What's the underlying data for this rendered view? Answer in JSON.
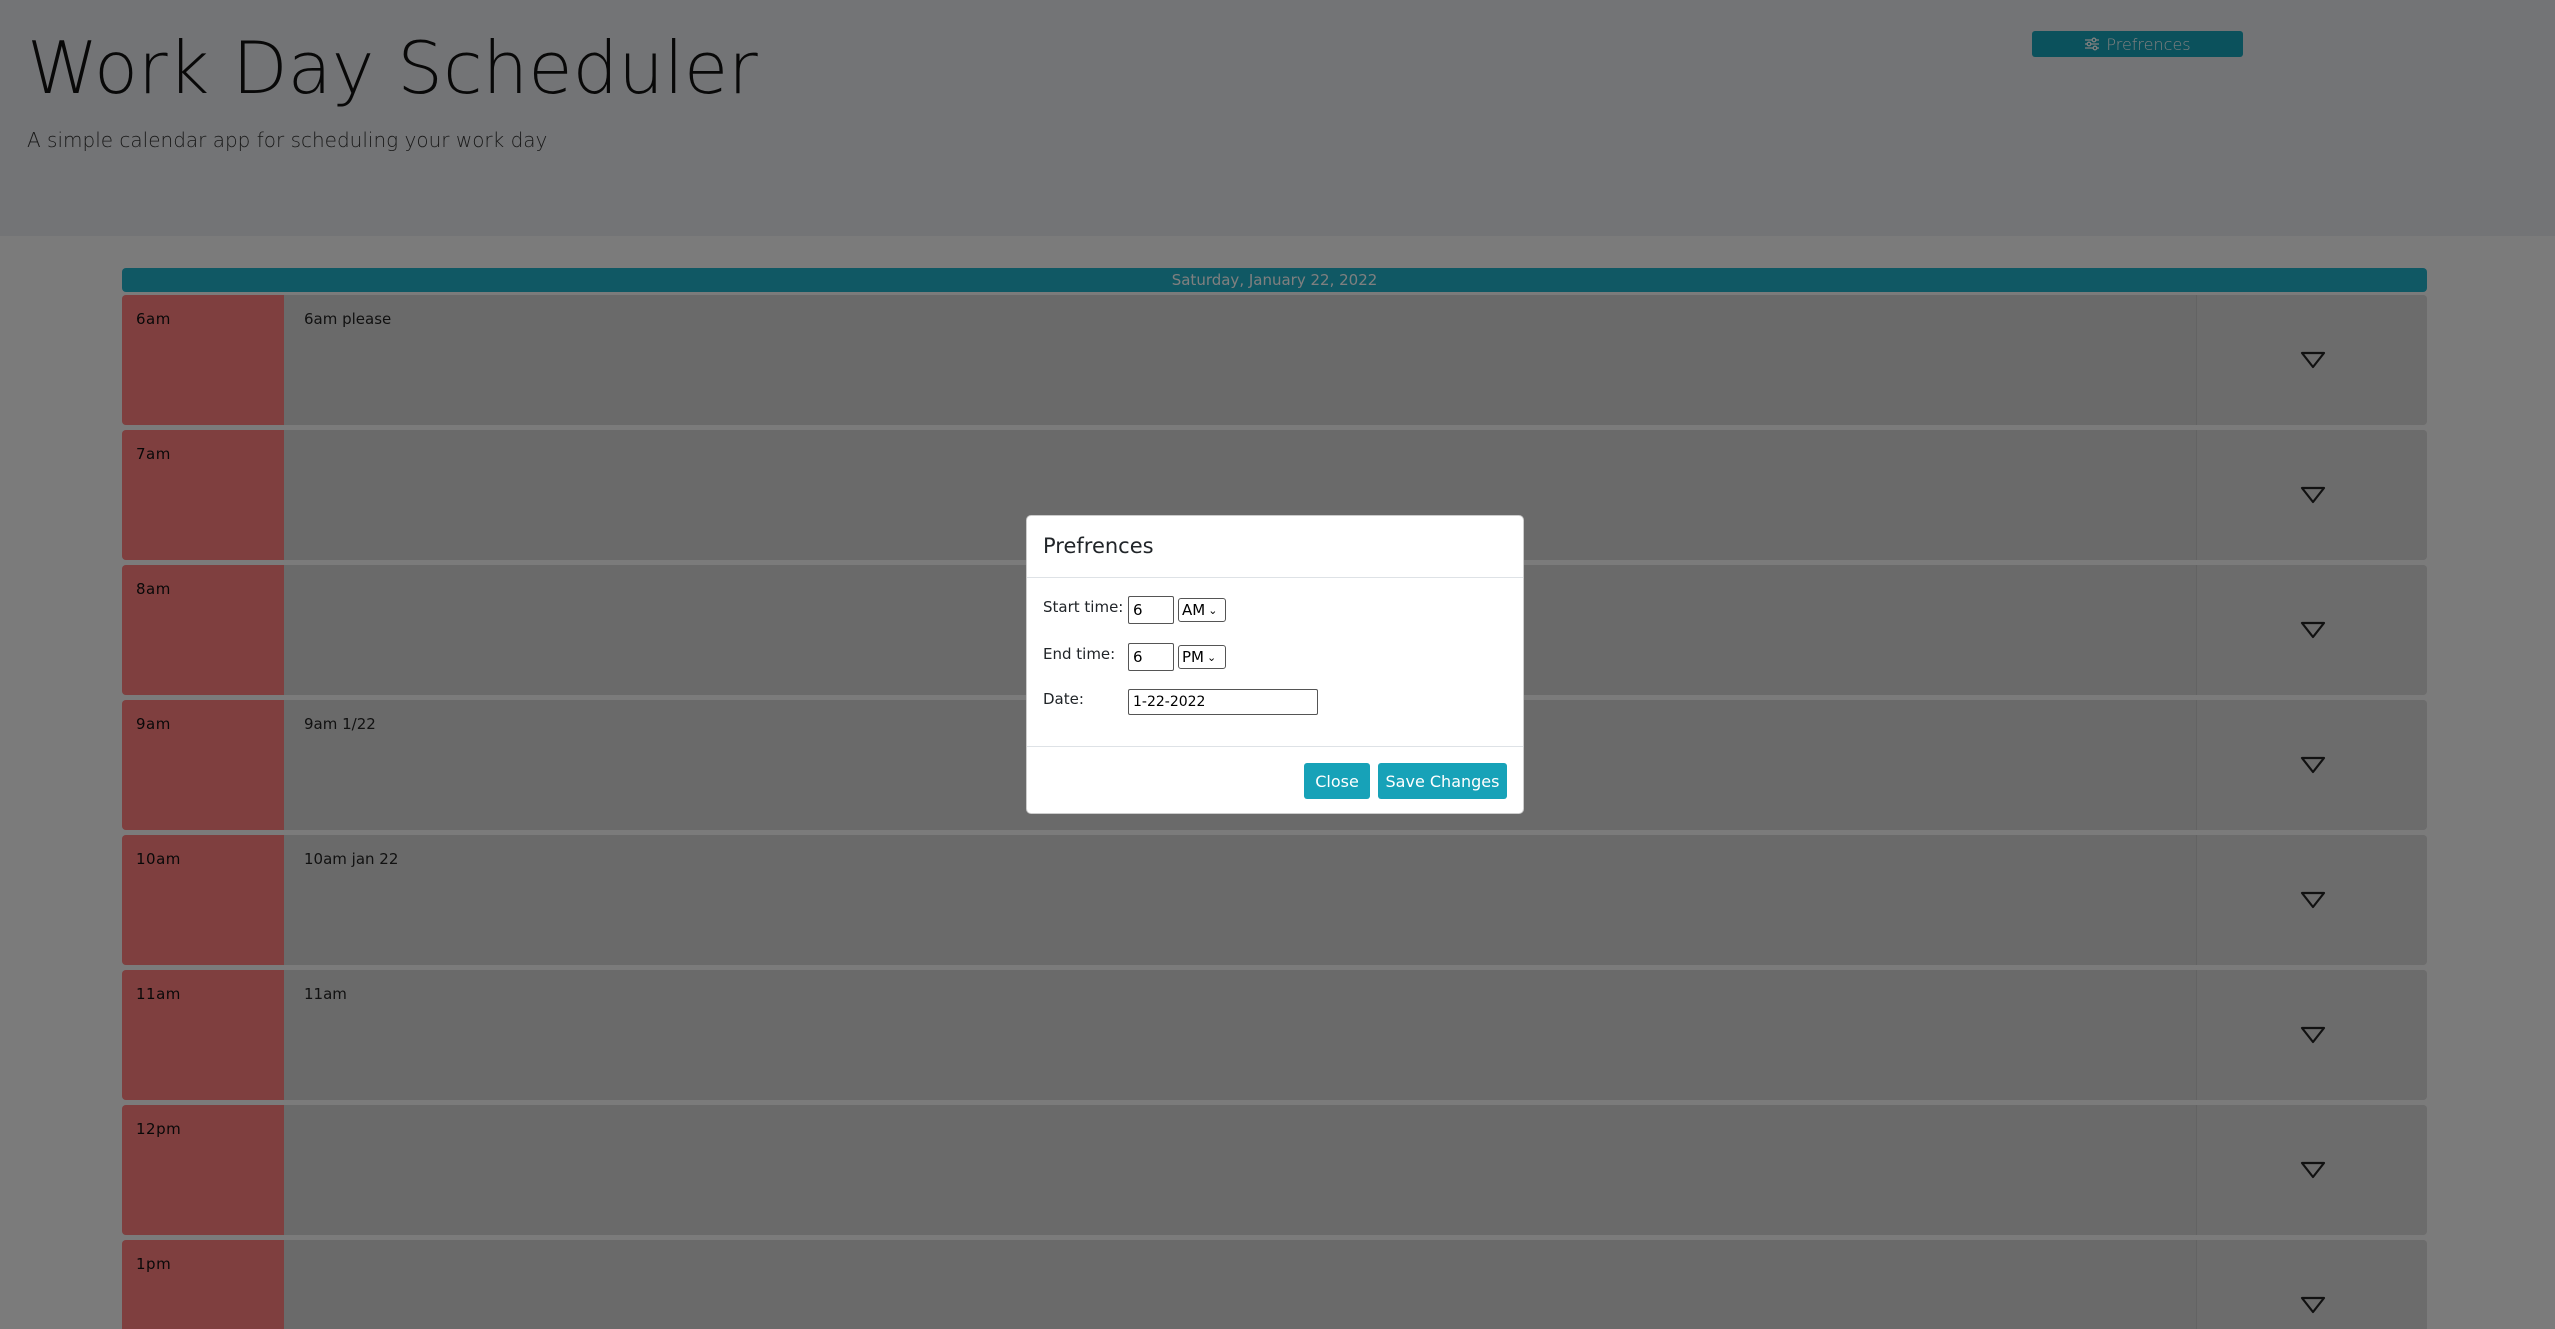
{
  "header": {
    "title": "Work Day Scheduler",
    "subtitle": "A simple calendar app for scheduling your work day",
    "preferences_label": "Prefrences"
  },
  "day": {
    "label": "Saturday, January 22, 2022"
  },
  "rows": [
    {
      "hour": "6am",
      "note": "6am please"
    },
    {
      "hour": "7am",
      "note": ""
    },
    {
      "hour": "8am",
      "note": ""
    },
    {
      "hour": "9am",
      "note": "9am 1/22"
    },
    {
      "hour": "10am",
      "note": "10am jan 22"
    },
    {
      "hour": "11am",
      "note": "11am"
    },
    {
      "hour": "12pm",
      "note": ""
    },
    {
      "hour": "1pm",
      "note": ""
    }
  ],
  "modal": {
    "title": "Prefrences",
    "start_label": "Start time:",
    "start_value": "6",
    "start_period": "AM",
    "end_label": "End time:",
    "end_value": "6",
    "end_period": "PM",
    "date_label": "Date:",
    "date_value": "1-22-2022",
    "close_label": "Close",
    "save_label": "Save Changes"
  },
  "colors": {
    "accent": "#17a2b8",
    "past_hour": "#ff7e7e",
    "header_bg": "#e7e9ec"
  },
  "icons": {
    "preferences": "sliders-icon",
    "save_row": "triangle-down-icon"
  }
}
